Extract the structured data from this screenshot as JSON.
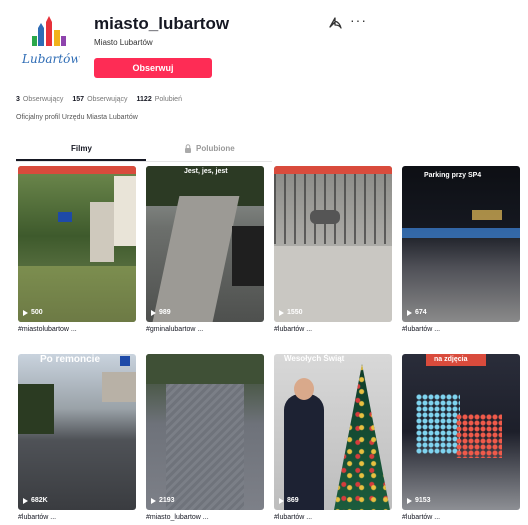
{
  "profile": {
    "username": "miasto_lubartow",
    "nickname": "Miasto Lubartów",
    "follow_label": "Obserwuj",
    "logo_text": "Lubartów",
    "bio": "Oficjalny profil Urzędu Miasta Lubartów"
  },
  "stats": [
    {
      "value": "3",
      "label": "Obserwujący"
    },
    {
      "value": "157",
      "label": "Obserwujący"
    },
    {
      "value": "1122",
      "label": "Polubień"
    }
  ],
  "tabs": [
    {
      "label": "Filmy",
      "active": true
    },
    {
      "label": "Polubione",
      "active": false
    }
  ],
  "videos": [
    {
      "views": "500",
      "caption": "#miastolubartow ...",
      "overlay": ""
    },
    {
      "views": "989",
      "caption": "#gminalubartow ...",
      "overlay": "Jest, jes, jest"
    },
    {
      "views": "1550",
      "caption": "#lubartów ...",
      "overlay": ""
    },
    {
      "views": "674",
      "caption": "#lubartów ...",
      "overlay": "Parking przy SP4"
    },
    {
      "views": "682K",
      "caption": "#lubartów ...",
      "overlay": "Po remoncie"
    },
    {
      "views": "2193",
      "caption": "#miasto_lubartow ...",
      "overlay": ""
    },
    {
      "views": "869",
      "caption": "#lubartów ...",
      "overlay": "Wesołych Świąt"
    },
    {
      "views": "9153",
      "caption": "#lubartów ...",
      "overlay": "na zdjęcia"
    }
  ]
}
